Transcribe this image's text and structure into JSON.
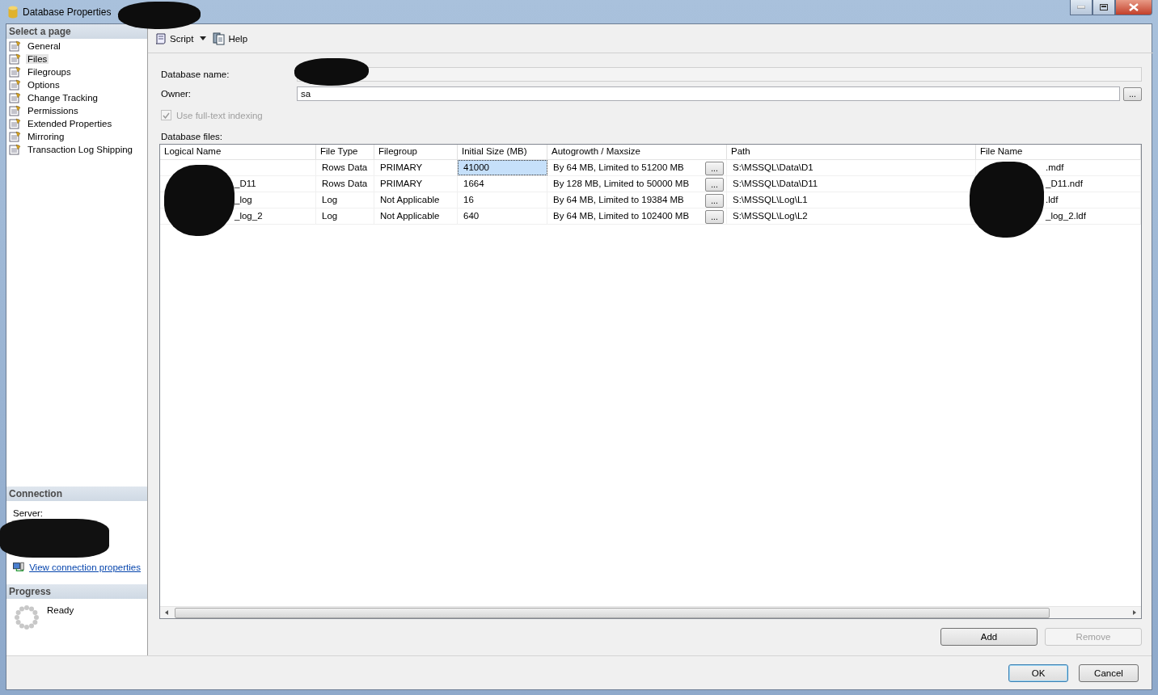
{
  "window": {
    "title": "Database Properties"
  },
  "sidebar": {
    "heading": "Select a page",
    "items": [
      {
        "label": "General",
        "selected": false
      },
      {
        "label": "Files",
        "selected": true
      },
      {
        "label": "Filegroups",
        "selected": false
      },
      {
        "label": "Options",
        "selected": false
      },
      {
        "label": "Change Tracking",
        "selected": false
      },
      {
        "label": "Permissions",
        "selected": false
      },
      {
        "label": "Extended Properties",
        "selected": false
      },
      {
        "label": "Mirroring",
        "selected": false
      },
      {
        "label": "Transaction Log Shipping",
        "selected": false
      }
    ]
  },
  "connection": {
    "heading": "Connection",
    "server_label": "Server:",
    "link": "View connection properties"
  },
  "progress": {
    "heading": "Progress",
    "status": "Ready"
  },
  "toolbar": {
    "script": "Script",
    "help": "Help"
  },
  "form": {
    "database_name_label": "Database name:",
    "owner_label": "Owner:",
    "owner": "sa",
    "browse": "...",
    "fulltext": {
      "label": "Use full-text indexing",
      "checked": true,
      "disabled": true
    }
  },
  "files": {
    "label": "Database files:",
    "columns": [
      "Logical Name",
      "File Type",
      "Filegroup",
      "Initial Size (MB)",
      "Autogrowth / Maxsize",
      "Path",
      "File Name"
    ],
    "rows": [
      {
        "file_type": "Rows Data",
        "filegroup": "PRIMARY",
        "initial_size": "41000",
        "size_selected": true,
        "autogrowth": "By 64 MB, Limited to 51200 MB",
        "browse": "...",
        "path": "S:\\MSSQL\\Data\\D1",
        "file_name": ".mdf"
      },
      {
        "logical_name": "_D11",
        "file_type": "Rows Data",
        "filegroup": "PRIMARY",
        "initial_size": "1664",
        "size_selected": false,
        "autogrowth": "By 128 MB, Limited to 50000 MB",
        "browse": "...",
        "path": "S:\\MSSQL\\Data\\D11",
        "file_name": "_D11.ndf"
      },
      {
        "logical_name": "_log",
        "file_type": "Log",
        "filegroup": "Not Applicable",
        "initial_size": "16",
        "size_selected": false,
        "autogrowth": "By 64 MB, Limited to 19384 MB",
        "browse": "...",
        "path": "S:\\MSSQL\\Log\\L1",
        "file_name": ".ldf"
      },
      {
        "logical_name": "_log_2",
        "file_type": "Log",
        "filegroup": "Not Applicable",
        "initial_size": "640",
        "size_selected": false,
        "autogrowth": "By 64 MB, Limited to 102400 MB",
        "browse": "...",
        "path": "S:\\MSSQL\\Log\\L2",
        "file_name": "_log_2.ldf"
      }
    ]
  },
  "buttons": [
    {
      "label": "Add",
      "disabled": false
    },
    {
      "label": "Remove",
      "disabled": true
    }
  ],
  "dialog_buttons": [
    {
      "label": "OK",
      "default": true
    },
    {
      "label": "Cancel",
      "default": false
    }
  ]
}
